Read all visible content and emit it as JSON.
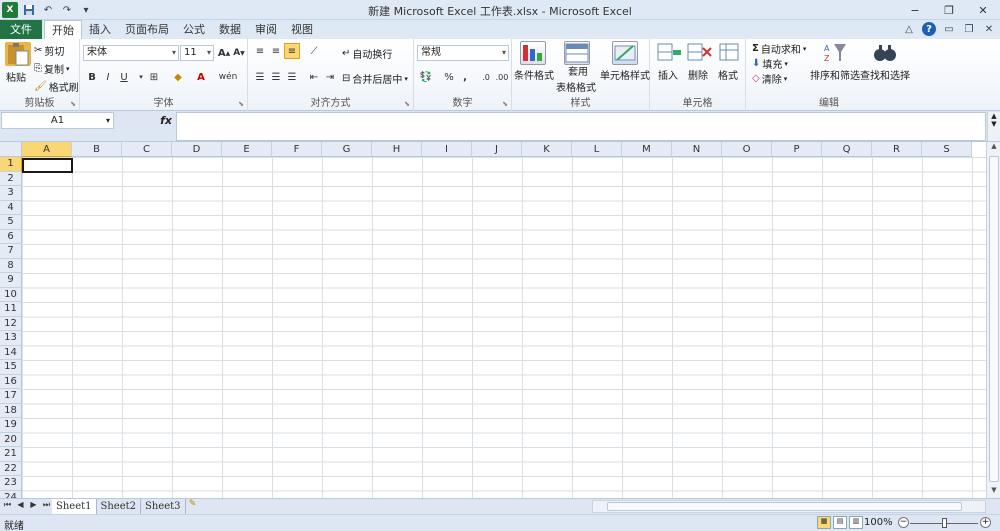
{
  "window": {
    "title": "新建 Microsoft Excel 工作表.xlsx - Microsoft Excel",
    "quick_access": [
      "excel-logo",
      "save-icon",
      "undo-icon",
      "redo-icon",
      "customize-icon"
    ],
    "controls": {
      "minimize": "−",
      "restore": "❐",
      "close": "✕"
    }
  },
  "tabs": {
    "file": "文件",
    "items": [
      "开始",
      "插入",
      "页面布局",
      "公式",
      "数据",
      "审阅",
      "视图"
    ],
    "active": "开始"
  },
  "ribbon": {
    "clipboard": {
      "label": "剪贴板",
      "paste": "粘贴",
      "cut": "剪切",
      "copy": "复制",
      "format_painter": "格式刷"
    },
    "font": {
      "label": "字体",
      "font_name": "宋体",
      "font_size": "11",
      "bold": "B",
      "italic": "I",
      "underline": "U"
    },
    "alignment": {
      "label": "对齐方式",
      "wrap_text": "自动换行",
      "merge_center": "合并后居中"
    },
    "number": {
      "label": "数字",
      "format": "常规",
      "percent": "%",
      "comma": ","
    },
    "styles": {
      "label": "样式",
      "conditional": "条件格式",
      "table_format": "套用\n表格格式",
      "table_format_1": "套用",
      "table_format_2": "表格格式",
      "cell_styles": "单元格样式"
    },
    "cells": {
      "label": "单元格",
      "insert": "插入",
      "delete": "删除",
      "format": "格式"
    },
    "editing": {
      "label": "编辑",
      "autosum": "自动求和",
      "fill": "填充",
      "clear": "清除",
      "sort_filter": "排序和筛选",
      "find_select": "查找和选择"
    }
  },
  "formula_bar": {
    "name_box": "A1",
    "fx": "fx",
    "value": ""
  },
  "grid": {
    "columns": [
      "A",
      "B",
      "C",
      "D",
      "E",
      "F",
      "G",
      "H",
      "I",
      "J",
      "K",
      "L",
      "M",
      "N",
      "O",
      "P",
      "Q",
      "R",
      "S"
    ],
    "rows": [
      "1",
      "2",
      "3",
      "4",
      "5",
      "6",
      "7",
      "8",
      "9",
      "10",
      "11",
      "12",
      "13",
      "14",
      "15",
      "16",
      "17",
      "18",
      "19",
      "20",
      "21",
      "22",
      "23",
      "24"
    ],
    "selected_cell": "A1"
  },
  "sheets": {
    "items": [
      "Sheet1",
      "Sheet2",
      "Sheet3"
    ],
    "active": "Sheet1"
  },
  "status": {
    "text": "就绪",
    "zoom": "100%"
  },
  "colors": {
    "accent": "#227447",
    "selection": "#f8d774"
  }
}
